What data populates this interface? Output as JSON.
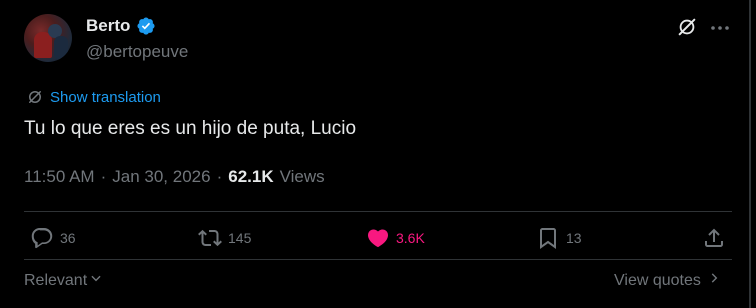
{
  "author": {
    "name": "Berto",
    "handle": "@bertopeuve",
    "verified": true
  },
  "translation": {
    "label": "Show translation"
  },
  "tweet": {
    "text": "Tu lo que eres es un hijo de puta, Lucio"
  },
  "meta": {
    "time": "11:50 AM",
    "separator1": "·",
    "date": "Jan 30, 2026",
    "separator2": "·",
    "views_count": "62.1K",
    "views_label": "Views"
  },
  "actions": {
    "replies": "36",
    "reposts": "145",
    "likes": "3.6K",
    "bookmarks": "13"
  },
  "footer": {
    "sort_label": "Relevant",
    "view_quotes_label": "View quotes"
  },
  "colors": {
    "background": "#000000",
    "text": "#e7e9ea",
    "muted": "#71767b",
    "accent": "#1d9bf0",
    "like": "#f91880",
    "divider": "#2f3336"
  }
}
